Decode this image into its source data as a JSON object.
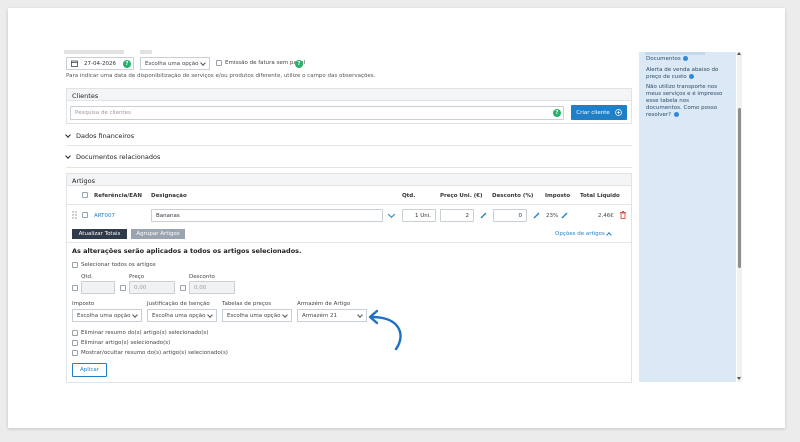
{
  "top": {
    "date_value": "27-04-2026",
    "select_placeholder": "Escolha uma opção",
    "paperless_label": "Emissão de fatura sem papel",
    "note": "Para indicar uma data de disponibilização de serviços e/ou produtos diferente, utilize o campo das observações."
  },
  "clients": {
    "title": "Clientes",
    "search_placeholder": "Pesquisa de clientes",
    "create_button": "Criar cliente"
  },
  "sections": {
    "financial": "Dados financeiros",
    "related_docs": "Documentos relacionados"
  },
  "articles": {
    "title": "Artigos",
    "headers": {
      "ref": "Referência/EAN",
      "designation": "Designação",
      "qty": "Qtd.",
      "unit_price": "Preço Uni. (€)",
      "discount": "Desconto (%)",
      "tax": "Imposto",
      "total": "Total Líquido"
    },
    "row": {
      "ref": "ART007",
      "designation": "Bananas",
      "qty": "1 Uni.",
      "unit_price": "2",
      "discount": "0",
      "tax": "23%",
      "total": "2,46€"
    },
    "update_totals": "Atualizar Totais",
    "group_articles": "Agrupar Artigos",
    "article_options": "Opções de artigos"
  },
  "bulk": {
    "heading": "As alterações serão aplicados a todos os artigos selecionados.",
    "select_all": "Selecionar todos os artigos",
    "qty_label": "Qtd.",
    "price_label": "Preço",
    "discount_label": "Desconto",
    "price_value": "0,00",
    "discount_value": "0,00",
    "tax_label": "Imposto",
    "exemption_label": "Justificação de Isenção",
    "price_tables_label": "Tabelas de preços",
    "warehouse_label": "Armazém de Artigo",
    "select_placeholder": "Escolha uma opção",
    "warehouse_value": "Armazém 21",
    "opt1": "Eliminar resumo do(s) artigo(s) selecionado(s)",
    "opt2": "Eliminar artigo(s) selecionado(s)",
    "opt3": "Mostrar/ocultar resumo do(s) artigo(s) selecionado(s)",
    "apply": "Aplicar"
  },
  "sidebar": {
    "line1": "Documentos",
    "item2a": "Alerta de venda abaixo do",
    "item2b": "preço de custo",
    "item3a": "Não utilizo transporte nos",
    "item3b": "meus serviços e é impresso",
    "item3c": "esse tabela nos",
    "item3d": "documentos. Como posso",
    "item3e": "resolver?"
  },
  "colors": {
    "accent": "#1f7fc7",
    "help_green": "#27b26b",
    "sidebar_bg": "#dbe9f7",
    "dark_button": "#2f3a4a",
    "grey_button": "#9aa4b0"
  }
}
